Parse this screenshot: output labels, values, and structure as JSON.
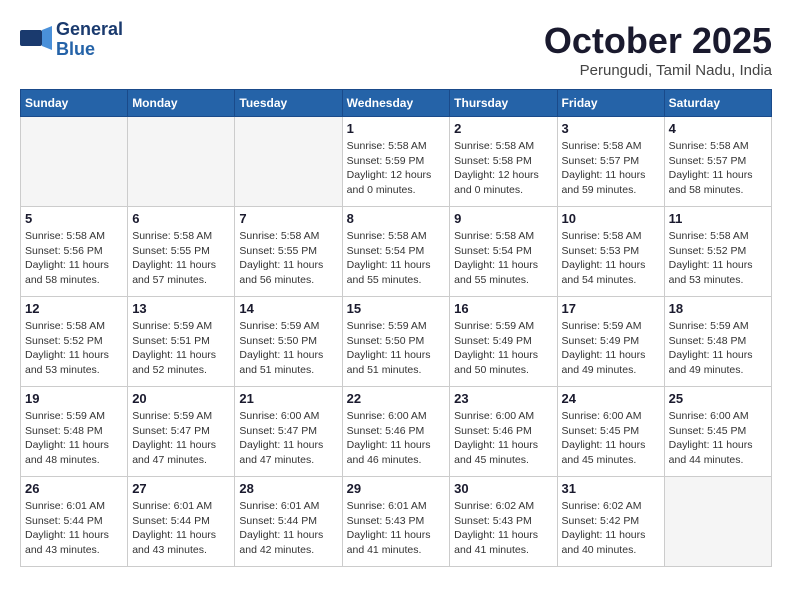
{
  "logo": {
    "line1": "General",
    "line2": "Blue",
    "tagline": ""
  },
  "title": "October 2025",
  "location": "Perungudi, Tamil Nadu, India",
  "headers": [
    "Sunday",
    "Monday",
    "Tuesday",
    "Wednesday",
    "Thursday",
    "Friday",
    "Saturday"
  ],
  "weeks": [
    [
      {
        "day": "",
        "info": ""
      },
      {
        "day": "",
        "info": ""
      },
      {
        "day": "",
        "info": ""
      },
      {
        "day": "1",
        "info": "Sunrise: 5:58 AM\nSunset: 5:59 PM\nDaylight: 12 hours\nand 0 minutes."
      },
      {
        "day": "2",
        "info": "Sunrise: 5:58 AM\nSunset: 5:58 PM\nDaylight: 12 hours\nand 0 minutes."
      },
      {
        "day": "3",
        "info": "Sunrise: 5:58 AM\nSunset: 5:57 PM\nDaylight: 11 hours\nand 59 minutes."
      },
      {
        "day": "4",
        "info": "Sunrise: 5:58 AM\nSunset: 5:57 PM\nDaylight: 11 hours\nand 58 minutes."
      }
    ],
    [
      {
        "day": "5",
        "info": "Sunrise: 5:58 AM\nSunset: 5:56 PM\nDaylight: 11 hours\nand 58 minutes."
      },
      {
        "day": "6",
        "info": "Sunrise: 5:58 AM\nSunset: 5:55 PM\nDaylight: 11 hours\nand 57 minutes."
      },
      {
        "day": "7",
        "info": "Sunrise: 5:58 AM\nSunset: 5:55 PM\nDaylight: 11 hours\nand 56 minutes."
      },
      {
        "day": "8",
        "info": "Sunrise: 5:58 AM\nSunset: 5:54 PM\nDaylight: 11 hours\nand 55 minutes."
      },
      {
        "day": "9",
        "info": "Sunrise: 5:58 AM\nSunset: 5:54 PM\nDaylight: 11 hours\nand 55 minutes."
      },
      {
        "day": "10",
        "info": "Sunrise: 5:58 AM\nSunset: 5:53 PM\nDaylight: 11 hours\nand 54 minutes."
      },
      {
        "day": "11",
        "info": "Sunrise: 5:58 AM\nSunset: 5:52 PM\nDaylight: 11 hours\nand 53 minutes."
      }
    ],
    [
      {
        "day": "12",
        "info": "Sunrise: 5:58 AM\nSunset: 5:52 PM\nDaylight: 11 hours\nand 53 minutes."
      },
      {
        "day": "13",
        "info": "Sunrise: 5:59 AM\nSunset: 5:51 PM\nDaylight: 11 hours\nand 52 minutes."
      },
      {
        "day": "14",
        "info": "Sunrise: 5:59 AM\nSunset: 5:50 PM\nDaylight: 11 hours\nand 51 minutes."
      },
      {
        "day": "15",
        "info": "Sunrise: 5:59 AM\nSunset: 5:50 PM\nDaylight: 11 hours\nand 51 minutes."
      },
      {
        "day": "16",
        "info": "Sunrise: 5:59 AM\nSunset: 5:49 PM\nDaylight: 11 hours\nand 50 minutes."
      },
      {
        "day": "17",
        "info": "Sunrise: 5:59 AM\nSunset: 5:49 PM\nDaylight: 11 hours\nand 49 minutes."
      },
      {
        "day": "18",
        "info": "Sunrise: 5:59 AM\nSunset: 5:48 PM\nDaylight: 11 hours\nand 49 minutes."
      }
    ],
    [
      {
        "day": "19",
        "info": "Sunrise: 5:59 AM\nSunset: 5:48 PM\nDaylight: 11 hours\nand 48 minutes."
      },
      {
        "day": "20",
        "info": "Sunrise: 5:59 AM\nSunset: 5:47 PM\nDaylight: 11 hours\nand 47 minutes."
      },
      {
        "day": "21",
        "info": "Sunrise: 6:00 AM\nSunset: 5:47 PM\nDaylight: 11 hours\nand 47 minutes."
      },
      {
        "day": "22",
        "info": "Sunrise: 6:00 AM\nSunset: 5:46 PM\nDaylight: 11 hours\nand 46 minutes."
      },
      {
        "day": "23",
        "info": "Sunrise: 6:00 AM\nSunset: 5:46 PM\nDaylight: 11 hours\nand 45 minutes."
      },
      {
        "day": "24",
        "info": "Sunrise: 6:00 AM\nSunset: 5:45 PM\nDaylight: 11 hours\nand 45 minutes."
      },
      {
        "day": "25",
        "info": "Sunrise: 6:00 AM\nSunset: 5:45 PM\nDaylight: 11 hours\nand 44 minutes."
      }
    ],
    [
      {
        "day": "26",
        "info": "Sunrise: 6:01 AM\nSunset: 5:44 PM\nDaylight: 11 hours\nand 43 minutes."
      },
      {
        "day": "27",
        "info": "Sunrise: 6:01 AM\nSunset: 5:44 PM\nDaylight: 11 hours\nand 43 minutes."
      },
      {
        "day": "28",
        "info": "Sunrise: 6:01 AM\nSunset: 5:44 PM\nDaylight: 11 hours\nand 42 minutes."
      },
      {
        "day": "29",
        "info": "Sunrise: 6:01 AM\nSunset: 5:43 PM\nDaylight: 11 hours\nand 41 minutes."
      },
      {
        "day": "30",
        "info": "Sunrise: 6:02 AM\nSunset: 5:43 PM\nDaylight: 11 hours\nand 41 minutes."
      },
      {
        "day": "31",
        "info": "Sunrise: 6:02 AM\nSunset: 5:42 PM\nDaylight: 11 hours\nand 40 minutes."
      },
      {
        "day": "",
        "info": ""
      }
    ]
  ]
}
